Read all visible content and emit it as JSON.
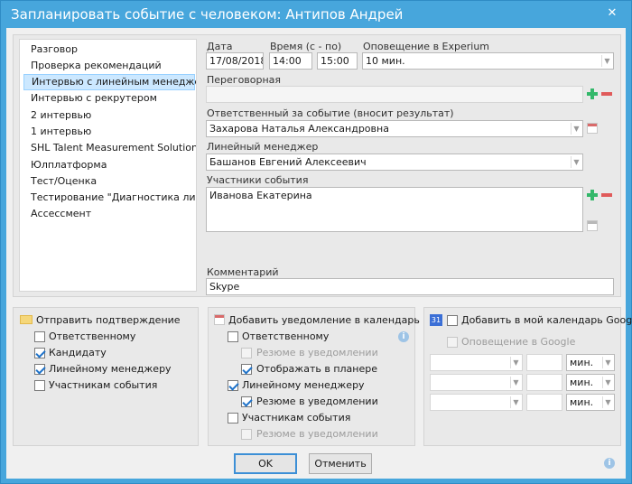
{
  "window": {
    "title": "Запланировать событие с человеком: Антипов Андрей",
    "close_glyph": "✕"
  },
  "event_types": [
    "Разговор",
    "Проверка рекомендаций",
    "Интервью с линейным менеджером",
    "Интервью с рекрутером",
    "2 интервью",
    "1 интервью",
    "SHL Talent Measurement Solutions",
    "Юлплатформа",
    "Тест/Оценка",
    "Тестирование \"Диагностика лидерства\"",
    "Ассессмент"
  ],
  "selected_index": 2,
  "form": {
    "date_label": "Дата",
    "date_value": "17/08/2018",
    "time_label": "Время (с - по)",
    "time_from": "14:00",
    "time_to": "15:00",
    "notify_label": "Оповещение в Experium",
    "notify_value": "10 мин.",
    "room_label": "Переговорная",
    "room_value": "",
    "responsible_label": "Ответственный за событие (вносит результат)",
    "responsible_value": "Захарова Наталья Александровна",
    "manager_label": "Линейный менеджер",
    "manager_value": "Башанов Евгений Алексеевич",
    "participants_label": "Участники события",
    "participants_value": "Иванова Екатерина",
    "comment_label": "Комментарий",
    "comment_value": "Skype"
  },
  "confirm": {
    "title": "Отправить подтверждение",
    "items": [
      {
        "label": "Ответственному",
        "checked": false
      },
      {
        "label": "Кандидату",
        "checked": true
      },
      {
        "label": "Линейному менеджеру",
        "checked": true
      },
      {
        "label": "Участникам события",
        "checked": false
      }
    ]
  },
  "calendar": {
    "title": "Добавить уведомление в календарь",
    "responsible": "Ответственному",
    "resume1": "Резюме в уведомлении",
    "show_planner": "Отображать в планере",
    "manager": "Линейному менеджеру",
    "resume2": "Резюме в уведомлении",
    "participants": "Участникам события",
    "resume3": "Резюме в уведомлении"
  },
  "google": {
    "icon_text": "31",
    "title": "Добавить в мой календарь Google",
    "notify": "Оповещение в Google",
    "rows": [
      {
        "unit": "мин."
      },
      {
        "unit": "мин."
      },
      {
        "unit": "мин."
      }
    ]
  },
  "buttons": {
    "ok": "OK",
    "cancel": "Отменить"
  },
  "colors": {
    "title_bar": "#47a6dc",
    "selection": "#cce8ff",
    "check": "#1e72c9",
    "add": "#33b86a",
    "remove": "#e05a5a"
  }
}
